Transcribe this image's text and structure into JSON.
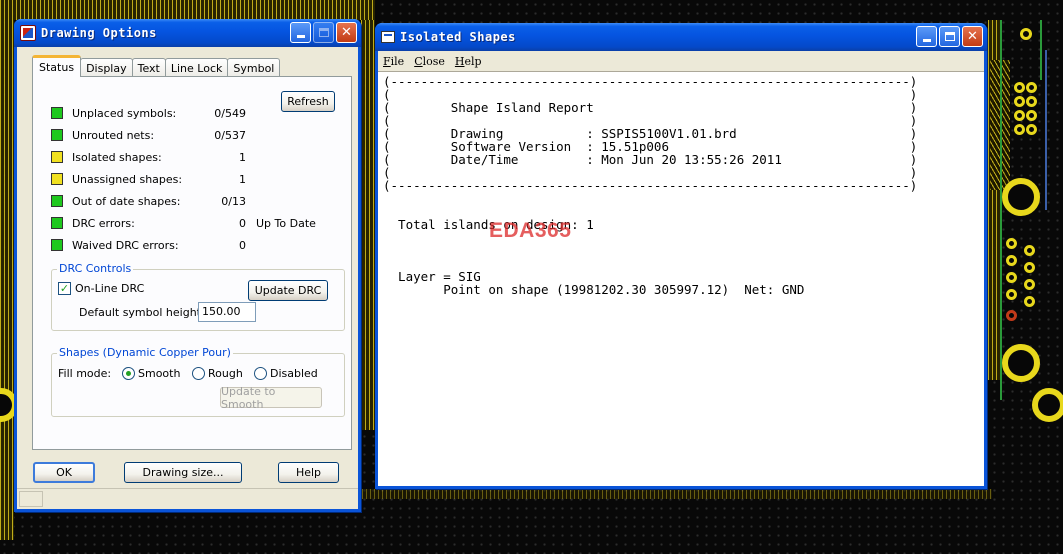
{
  "drawing_options": {
    "title": "Drawing Options",
    "tabs": [
      {
        "label": "Status",
        "active": true
      },
      {
        "label": "Display",
        "active": false
      },
      {
        "label": "Text",
        "active": false
      },
      {
        "label": "Line Lock",
        "active": false
      },
      {
        "label": "Symbol",
        "active": false
      }
    ],
    "refresh_label": "Refresh",
    "status_items": [
      {
        "label": "Unplaced symbols:",
        "value": "0/549",
        "extra": "",
        "color": "#1ec81e"
      },
      {
        "label": "Unrouted nets:",
        "value": "0/537",
        "extra": "",
        "color": "#1ec81e"
      },
      {
        "label": "Isolated shapes:",
        "value": "1",
        "extra": "",
        "color": "#f0e020"
      },
      {
        "label": "Unassigned shapes:",
        "value": "1",
        "extra": "",
        "color": "#f0e020"
      },
      {
        "label": "Out of date shapes:",
        "value": "0/13",
        "extra": "",
        "color": "#1ec81e"
      },
      {
        "label": "DRC errors:",
        "value": "0",
        "extra": "Up To Date",
        "color": "#1ec81e"
      },
      {
        "label": "Waived DRC errors:",
        "value": "0",
        "extra": "",
        "color": "#1ec81e"
      }
    ],
    "drc_controls": {
      "group_label": "DRC Controls",
      "online_drc_label": "On-Line DRC",
      "online_drc_checked": true,
      "update_drc_label": "Update DRC",
      "default_symbol_height_label": "Default symbol height:",
      "default_symbol_height_value": "150.00"
    },
    "shapes": {
      "group_label": "Shapes (Dynamic Copper Pour)",
      "fill_mode_label": "Fill mode:",
      "options": [
        {
          "label": "Smooth",
          "selected": true
        },
        {
          "label": "Rough",
          "selected": false
        },
        {
          "label": "Disabled",
          "selected": false
        }
      ],
      "update_to_smooth_label": "Update to Smooth"
    },
    "ok_label": "OK",
    "drawing_size_label": "Drawing size...",
    "help_label": "Help"
  },
  "isolated_shapes": {
    "title": "Isolated Shapes",
    "menu": [
      {
        "label": "File",
        "hotkey": "F",
        "rest": "ile"
      },
      {
        "label": "Close",
        "hotkey": "C",
        "rest": "lose"
      },
      {
        "label": "Help",
        "hotkey": "H",
        "rest": "elp"
      }
    ],
    "report_lines": [
      "(---------------------------------------------------------------------)",
      "(                                                                     )",
      "(        Shape Island Report                                          )",
      "(                                                                     )",
      "(        Drawing           : SSPIS5100V1.01.brd                       )",
      "(        Software Version  : 15.51p006                                )",
      "(        Date/Time         : Mon Jun 20 13:55:26 2011                 )",
      "(                                                                     )",
      "(---------------------------------------------------------------------)",
      "",
      "",
      "  Total islands on design: 1",
      "",
      "",
      "",
      "  Layer = SIG",
      "        Point on shape (19981202.30 305997.12)  Net: GND"
    ],
    "watermark": "EDA365"
  }
}
